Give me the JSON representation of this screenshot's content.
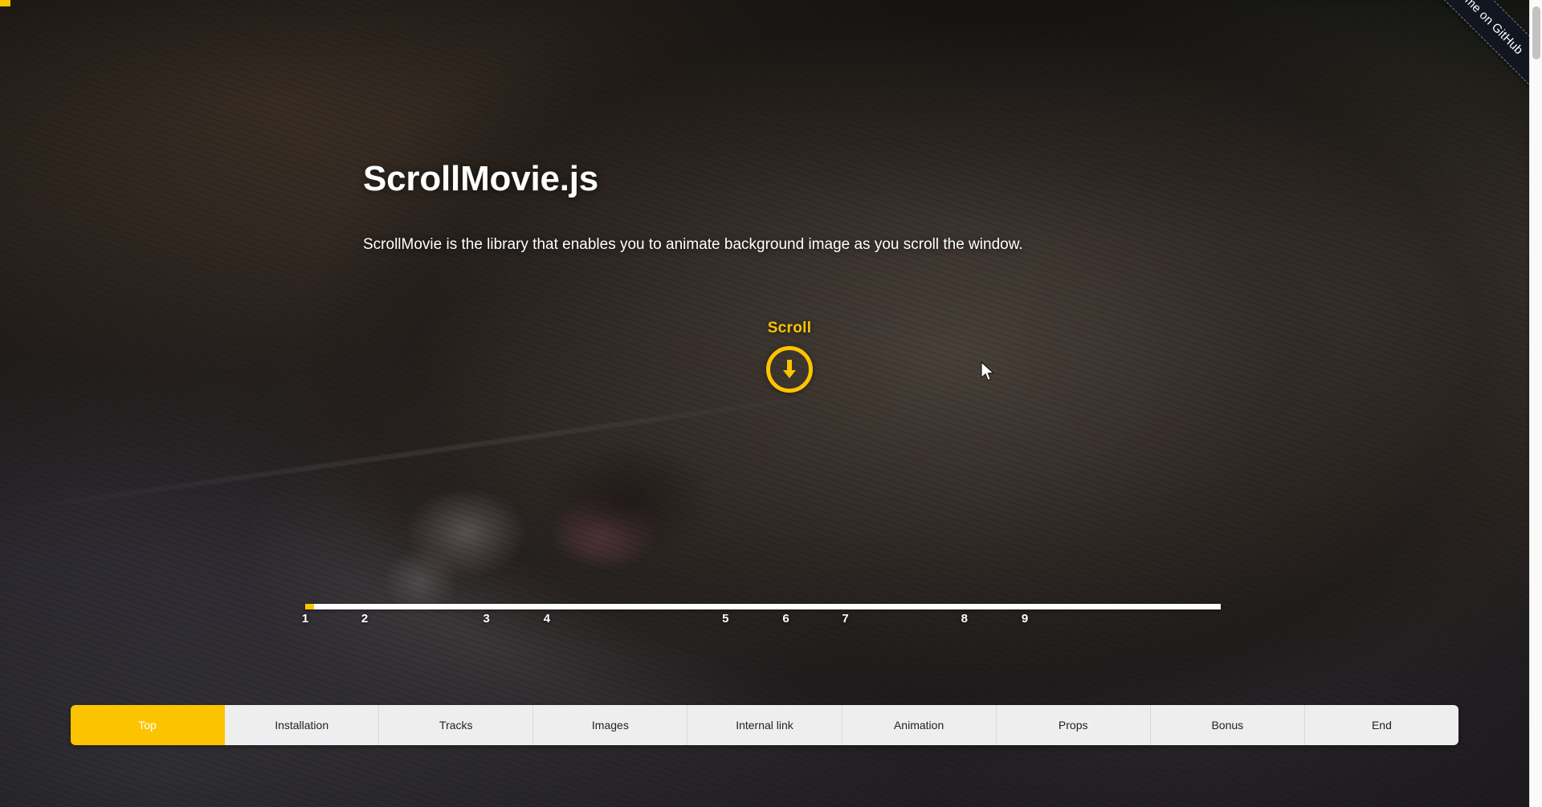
{
  "site": {
    "title": "ScrollMovie.js",
    "subtitle": "ScrollMovie is the library that enables you to animate background image as you scroll the window."
  },
  "ribbon": {
    "label": "Fork me on GitHub",
    "color": "#121621"
  },
  "scroll_cue": {
    "label": "Scroll",
    "icon": "arrow-down-circle-icon",
    "color": "#fcc400"
  },
  "track": {
    "labels": [
      "1",
      "2",
      "3",
      "4",
      "5",
      "6",
      "7",
      "8",
      "9"
    ],
    "current": 1,
    "fill_color": "#fcc400",
    "bar_color": "#ffffff"
  },
  "tabs": [
    {
      "label": "Top",
      "active": true
    },
    {
      "label": "Installation",
      "active": false
    },
    {
      "label": "Tracks",
      "active": false
    },
    {
      "label": "Images",
      "active": false
    },
    {
      "label": "Internal link",
      "active": false
    },
    {
      "label": "Animation",
      "active": false
    },
    {
      "label": "Props",
      "active": false
    },
    {
      "label": "Bonus",
      "active": false
    },
    {
      "label": "End",
      "active": false
    }
  ],
  "theme": {
    "accent": "#fcc400",
    "tab_bg": "#eeeeee",
    "tab_text": "#222222",
    "active_tab_text": "#ffffff"
  }
}
